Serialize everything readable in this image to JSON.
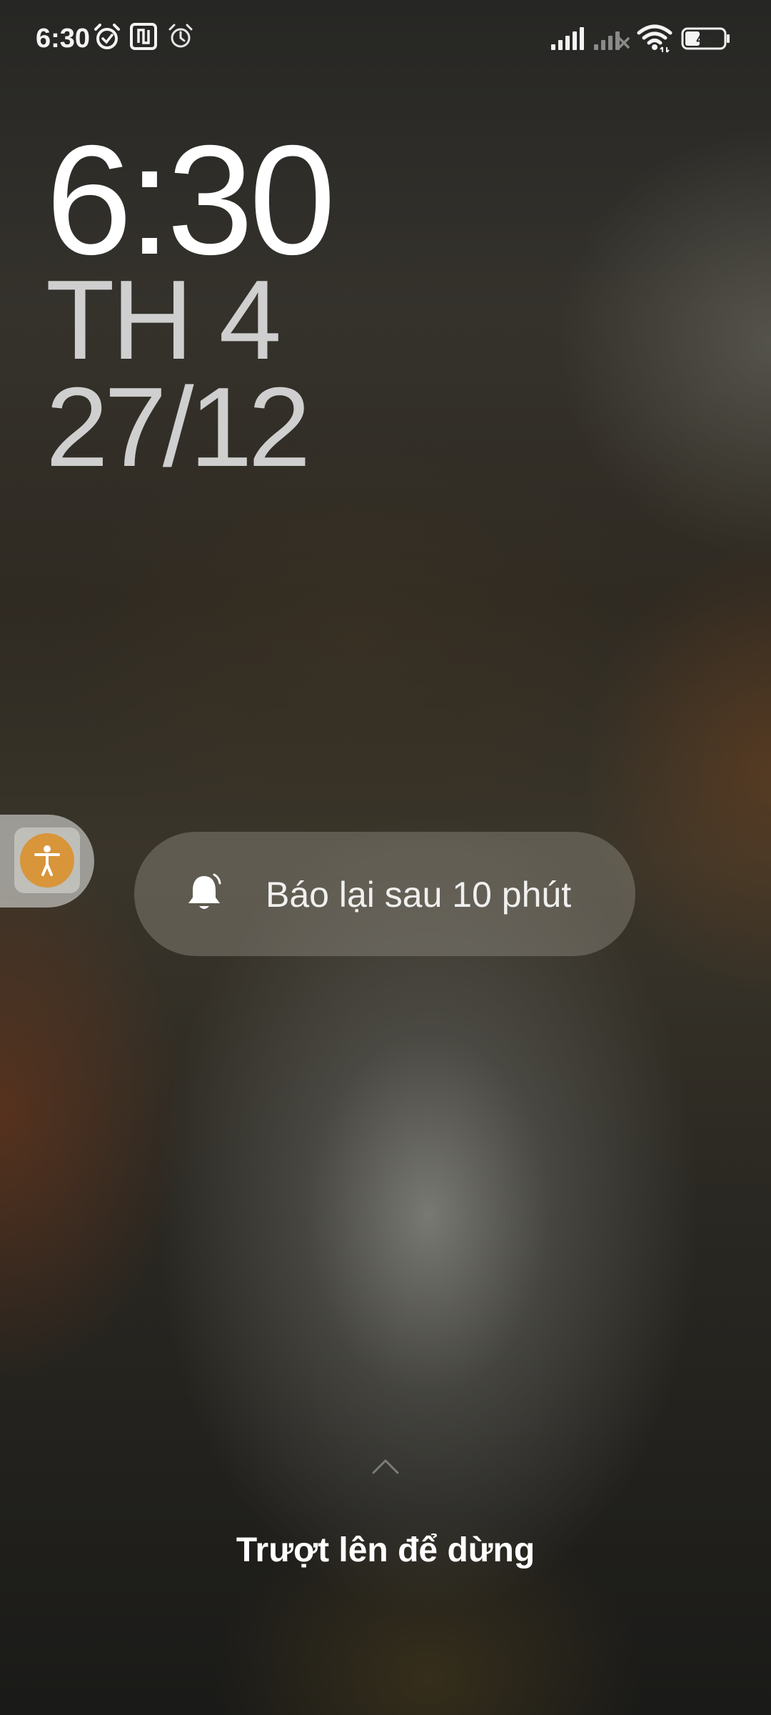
{
  "status_bar": {
    "time": "6:30",
    "icons": [
      "alarm-clock-icon",
      "nfc-icon",
      "alarm-icon",
      "signal-full-icon",
      "signal-none-icon",
      "wifi-icon",
      "battery-icon"
    ],
    "battery_level": "40"
  },
  "lock_clock": {
    "time": "6:30",
    "day": "TH 4",
    "date": "27/12"
  },
  "alarm": {
    "snooze_label": "Báo lại sau 10 phút",
    "slide_hint": "Trượt lên để dừng"
  },
  "colors": {
    "accessibility_button": "#d8953a",
    "text": "#ffffff"
  }
}
